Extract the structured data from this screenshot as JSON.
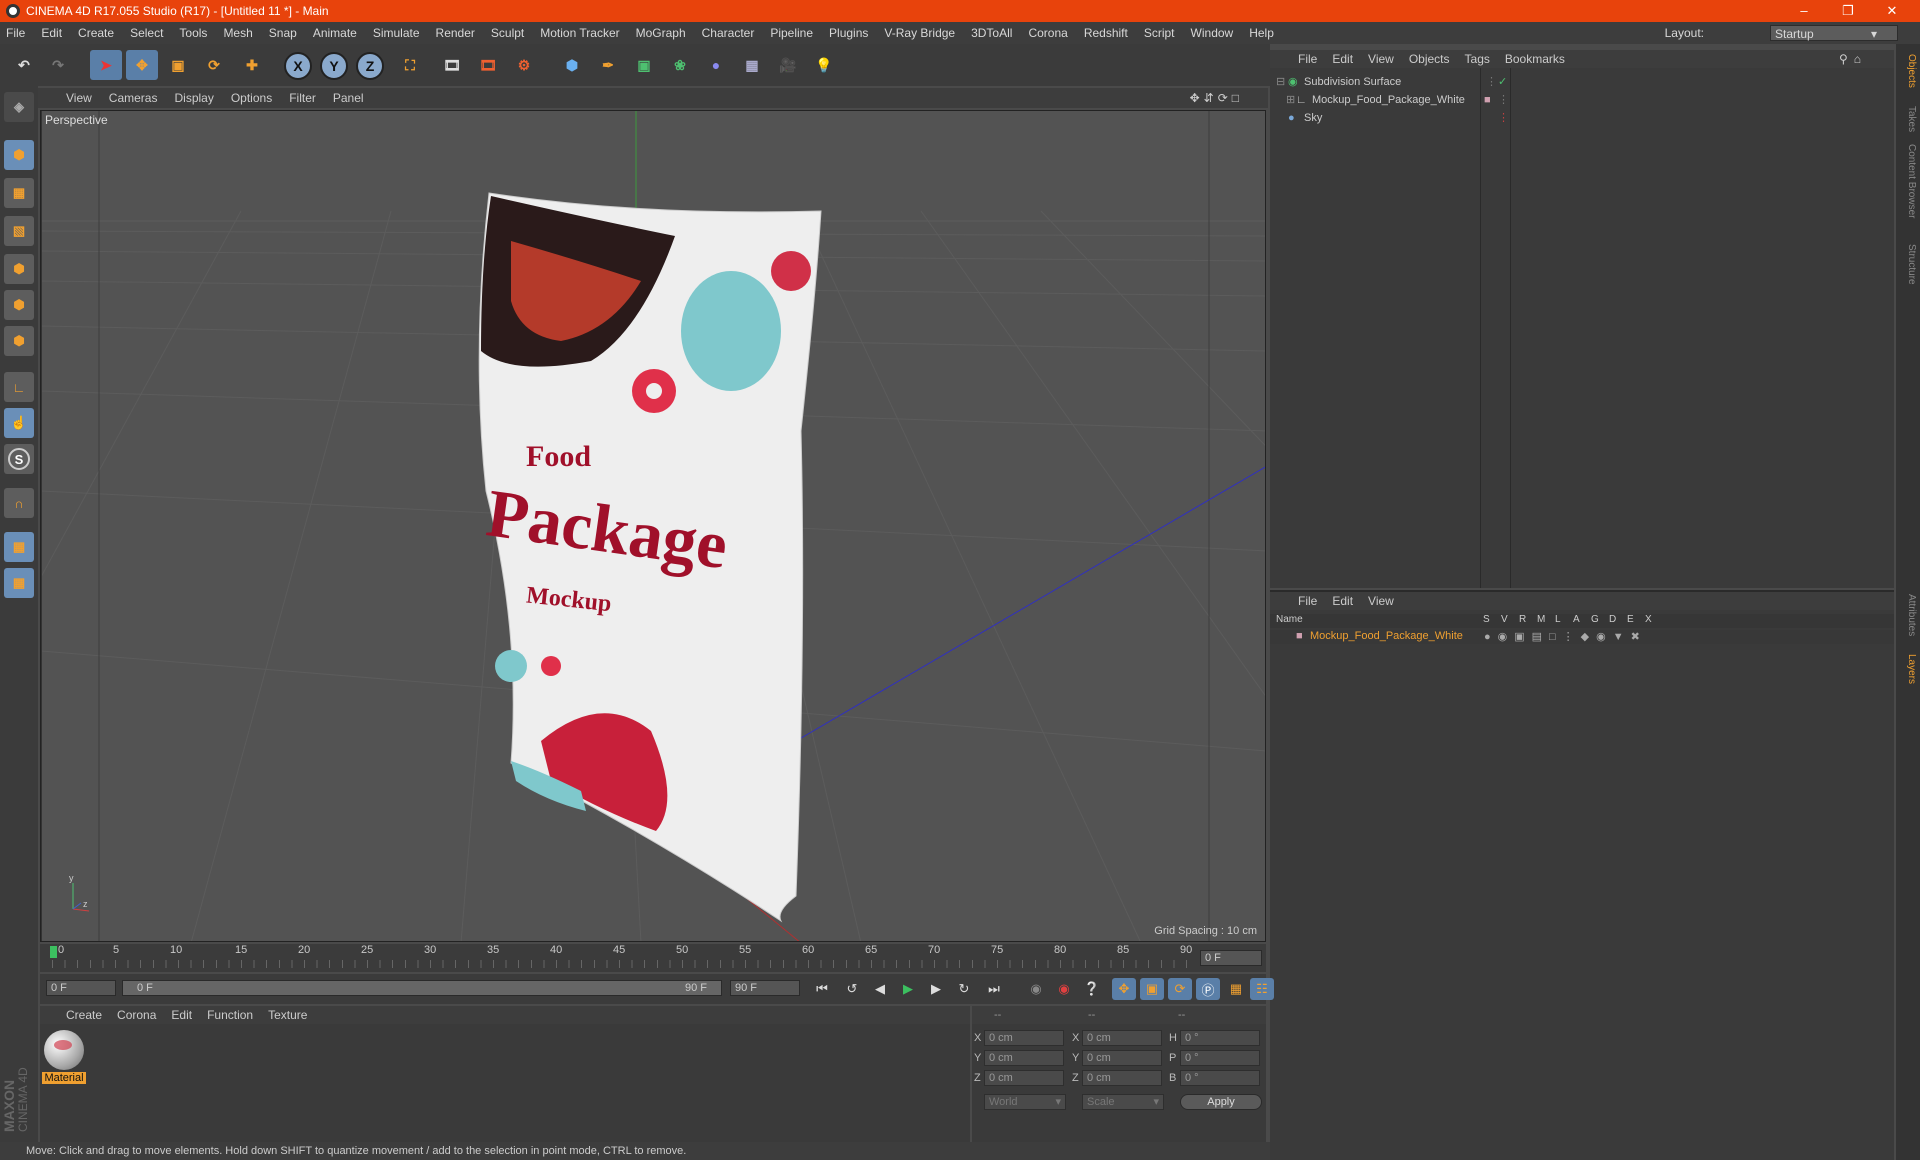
{
  "window": {
    "title": "CINEMA 4D R17.055 Studio (R17) - [Untitled 11 *] - Main"
  },
  "menu": [
    "File",
    "Edit",
    "Create",
    "Select",
    "Tools",
    "Mesh",
    "Snap",
    "Animate",
    "Simulate",
    "Render",
    "Sculpt",
    "Motion Tracker",
    "MoGraph",
    "Character",
    "Pipeline",
    "Plugins",
    "V-Ray Bridge",
    "3DToAll",
    "Corona",
    "Redshift",
    "Script",
    "Window",
    "Help"
  ],
  "layout": {
    "label": "Layout:",
    "value": "Startup"
  },
  "toolbar": {
    "x": "X",
    "y": "Y",
    "z": "Z"
  },
  "left_tools": {
    "s_label": "S"
  },
  "viewport": {
    "menu": [
      "View",
      "Cameras",
      "Display",
      "Options",
      "Filter",
      "Panel"
    ],
    "label": "Perspective",
    "grid_spacing": "Grid Spacing : 10 cm",
    "package_text": {
      "line1": "Food",
      "line2": "Package",
      "line3": "Mockup"
    },
    "axis": {
      "y": "y",
      "z": "z"
    }
  },
  "objects": {
    "menu": [
      "File",
      "Edit",
      "View",
      "Objects",
      "Tags",
      "Bookmarks"
    ],
    "items": [
      {
        "name": "Subdivision Surface"
      },
      {
        "name": "Mockup_Food_Package_White"
      },
      {
        "name": "Sky"
      }
    ]
  },
  "layers": {
    "menu": [
      "File",
      "Edit",
      "View"
    ],
    "header": {
      "name": "Name",
      "cols": [
        "S",
        "V",
        "R",
        "M",
        "L",
        "A",
        "G",
        "D",
        "E",
        "X"
      ]
    },
    "rows": [
      {
        "name": "Mockup_Food_Package_White"
      }
    ]
  },
  "right_tabs": [
    "Objects",
    "Takes",
    "Content Browser",
    "Structure",
    "Attributes",
    "Layers"
  ],
  "timeline": {
    "ticks": [
      "0",
      "5",
      "10",
      "15",
      "20",
      "25",
      "30",
      "35",
      "40",
      "45",
      "50",
      "55",
      "60",
      "65",
      "70",
      "75",
      "80",
      "85",
      "90"
    ],
    "frame_right": "0 F",
    "start": "0 F",
    "range_left": "0 F",
    "range_right": "90 F",
    "end": "90 F"
  },
  "materials": {
    "menu": [
      "Create",
      "Corona",
      "Edit",
      "Function",
      "Texture"
    ],
    "items": [
      {
        "name": "Material"
      }
    ]
  },
  "coordinates": {
    "headers": [
      "--",
      "--",
      "--"
    ],
    "rows": [
      {
        "a": "X",
        "av": "0 cm",
        "b": "X",
        "bv": "0 cm",
        "c": "H",
        "cv": "0 °"
      },
      {
        "a": "Y",
        "av": "0 cm",
        "b": "Y",
        "bv": "0 cm",
        "c": "P",
        "cv": "0 °"
      },
      {
        "a": "Z",
        "av": "0 cm",
        "b": "Z",
        "bv": "0 cm",
        "c": "B",
        "cv": "0 °"
      }
    ],
    "space": "World",
    "mode": "Scale",
    "apply": "Apply"
  },
  "brand": {
    "line1": "MAXON",
    "line2": "CINEMA 4D"
  },
  "status": "Move: Click and drag to move elements. Hold down SHIFT to quantize movement / add to the selection in point mode, CTRL to remove.",
  "colors": {
    "title_bar": "#e8430c",
    "accent": "#f0a030",
    "selection_blue": "#5a7fa8"
  }
}
